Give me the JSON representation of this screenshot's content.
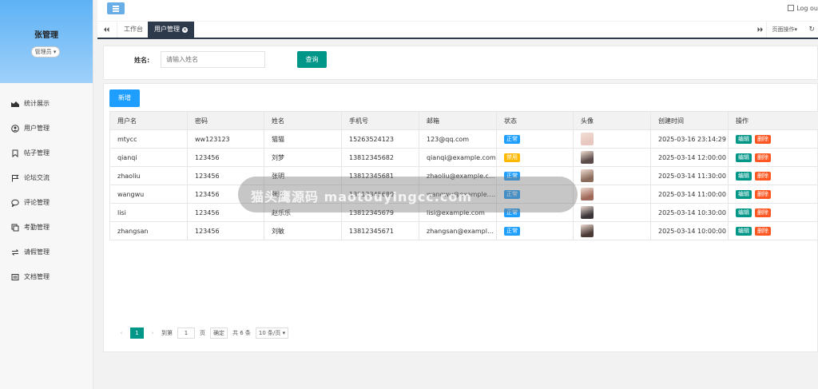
{
  "sidebar": {
    "user_name": "张管理",
    "role": "管理员",
    "items": [
      {
        "label": "统计展示",
        "icon": "chart-area-icon"
      },
      {
        "label": "用户管理",
        "icon": "user-circle-icon"
      },
      {
        "label": "帖子管理",
        "icon": "bookmark-icon"
      },
      {
        "label": "论坛交流",
        "icon": "flag-icon"
      },
      {
        "label": "评论管理",
        "icon": "comment-icon"
      },
      {
        "label": "考勤管理",
        "icon": "copy-icon"
      },
      {
        "label": "请假管理",
        "icon": "exchange-icon"
      },
      {
        "label": "文档管理",
        "icon": "list-icon"
      }
    ]
  },
  "topbar": {
    "menu_toggle_icon": "menu-icon",
    "logout_label": "Log ou"
  },
  "tabs": {
    "items": [
      {
        "label": "工作台"
      },
      {
        "label": "用户管理"
      }
    ],
    "page_ops_label": "页面操作",
    "refresh_icon": "refresh-icon"
  },
  "search": {
    "label": "姓名:",
    "placeholder": "请输入姓名",
    "button_label": "查询"
  },
  "table": {
    "add_label": "新增",
    "columns": [
      "用户名",
      "密码",
      "姓名",
      "手机号",
      "邮箱",
      "状态",
      "头像",
      "创建时间",
      "操作"
    ],
    "rows": [
      {
        "username": "mtycc",
        "password": "ww123123",
        "name": "猫猫",
        "phone": "15263524123",
        "email": "123@qq.com",
        "status": "正常",
        "status_type": "normal",
        "created": "2025-03-16 23:14:29",
        "avatar_color": "#e8c8c0"
      },
      {
        "username": "qianqi",
        "password": "123456",
        "name": "刘梦",
        "phone": "13812345682",
        "email": "qianqi@example.com",
        "status": "禁用",
        "status_type": "disabled",
        "created": "2025-03-14 12:00:00",
        "avatar_color": "#5a4a48"
      },
      {
        "username": "zhaoliu",
        "password": "123456",
        "name": "张明",
        "phone": "13812345681",
        "email": "zhaoliu@example.com",
        "status": "正常",
        "status_type": "normal",
        "created": "2025-03-14 11:30:00",
        "avatar_color": "#8a6a5a"
      },
      {
        "username": "wangwu",
        "password": "123456",
        "name": "张颖",
        "phone": "13812345680",
        "email": "wangwu@example.com",
        "status": "正常",
        "status_type": "normal",
        "created": "2025-03-14 11:00:00",
        "avatar_color": "#a06858"
      },
      {
        "username": "lisi",
        "password": "123456",
        "name": "赵乐乐",
        "phone": "13812345679",
        "email": "lisi@example.com",
        "status": "正常",
        "status_type": "normal",
        "created": "2025-03-14 10:30:00",
        "avatar_color": "#3a3438"
      },
      {
        "username": "zhangsan",
        "password": "123456",
        "name": "刘敏",
        "phone": "13812345671",
        "email": "zhangsan@example.com",
        "status": "正常",
        "status_type": "normal",
        "created": "2025-03-14 10:00:00",
        "avatar_color": "#4a3a36"
      }
    ],
    "edit_label": "编辑",
    "delete_label": "删除"
  },
  "pagination": {
    "current_page": "1",
    "goto_label": "到第",
    "goto_value": "1",
    "page_unit": "页",
    "confirm_label": "确定",
    "total_label": "共 6 条",
    "page_size_label": "10 条/页"
  },
  "watermark": {
    "text": "猫头鹰源码 maotouyingcc.com"
  }
}
